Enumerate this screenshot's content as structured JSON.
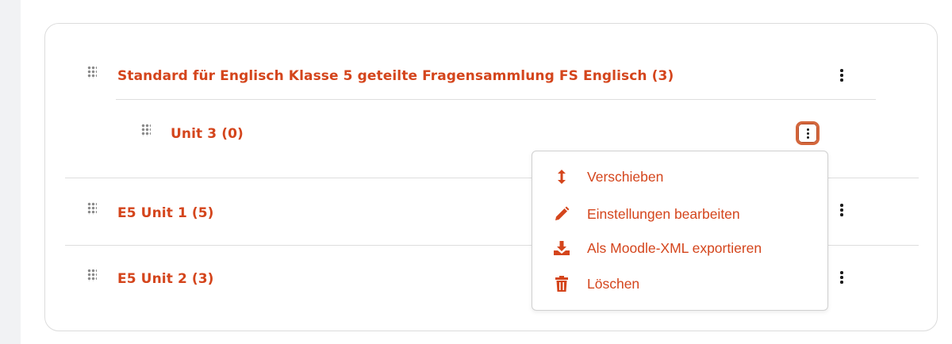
{
  "categories": [
    {
      "title": "Standard für Englisch Klasse 5 geteilte Fragensammlung FS Englisch (3)"
    },
    {
      "title": "Unit 3 (0)"
    },
    {
      "title": "E5 Unit 1 (5)"
    },
    {
      "title": "E5 Unit 2 (3)"
    }
  ],
  "menu": {
    "items": [
      {
        "label": "Verschieben",
        "icon": "move-vertical-icon"
      },
      {
        "label": "Einstellungen bearbeiten",
        "icon": "pencil-icon"
      },
      {
        "label": "Als Moodle-XML exportieren",
        "icon": "download-icon"
      },
      {
        "label": "Löschen",
        "icon": "trash-icon"
      }
    ]
  },
  "colors": {
    "accent": "#d4451c",
    "focus_ring": "#d4663b",
    "border": "#dcdcdc",
    "left_strip": "#f1f2f4"
  }
}
